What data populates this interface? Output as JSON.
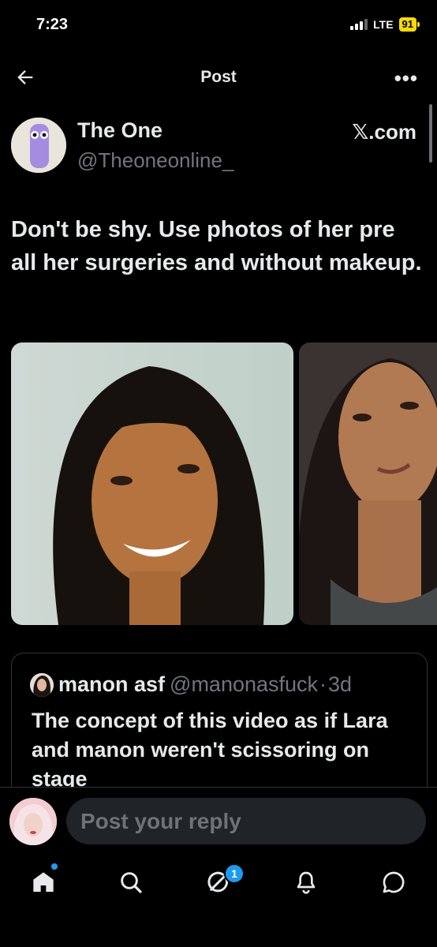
{
  "status_bar": {
    "time": "7:23",
    "network": "LTE",
    "battery": "91"
  },
  "header": {
    "title": "Post"
  },
  "post": {
    "author_name": "The One",
    "author_handle": "@Theoneonline_",
    "source": "𝕏.com",
    "text": "Don't be shy. Use photos of her pre all her surgeries and without makeup.",
    "photos": [
      "photo-1",
      "photo-2"
    ]
  },
  "quote": {
    "name": "manon asf",
    "handle": "@manonasfuck",
    "separator": "·",
    "time": "3d",
    "text": "The concept of this video as if Lara and manon weren't scissoring on stage"
  },
  "reply": {
    "placeholder": "Post your reply"
  },
  "tabbar": {
    "items": [
      "home-icon",
      "search-icon",
      "grok-icon",
      "notifications-icon",
      "messages-icon"
    ],
    "badge_count": "1"
  },
  "colors": {
    "background": "#000000",
    "text": "#e7e9ea",
    "secondary": "#71767b",
    "accent": "#1d9bf0",
    "battery": "#f5d90a"
  }
}
